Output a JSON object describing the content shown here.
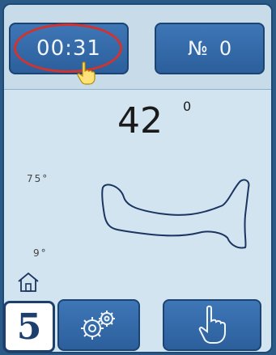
{
  "header": {
    "timer_value": "00:31",
    "counter_label": "№",
    "counter_value": "0"
  },
  "readout": {
    "angle_value": "42",
    "angle_unit": "0"
  },
  "scale": {
    "max_label": "75°",
    "min_label": "9°"
  },
  "overlay": {
    "step_number": "5"
  },
  "icons": {
    "cursor": "hand-pointer-icon",
    "home": "home-icon",
    "settings": "gears-icon",
    "manual": "hand-pointing-up-icon"
  },
  "colors": {
    "button": "#2c5f9c",
    "highlight": "#d2332f",
    "screen": "#d2e4f0",
    "badge_text": "#1d3f6e"
  }
}
